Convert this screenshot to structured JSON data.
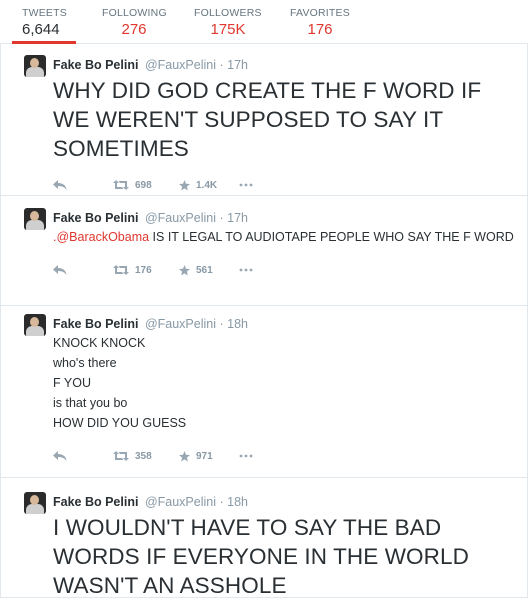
{
  "profile_stats": {
    "tweets": {
      "label": "TWEETS",
      "value": "6,644"
    },
    "following": {
      "label": "FOLLOWING",
      "value": "276"
    },
    "followers": {
      "label": "FOLLOWERS",
      "value": "175K"
    },
    "favorites": {
      "label": "FAVORITES",
      "value": "176"
    }
  },
  "colors": {
    "accent": "#e0372f",
    "muted": "#8899a6",
    "text": "#292f33",
    "border": "#e1e8ed"
  },
  "icons": {
    "reply": "reply-arrow-icon",
    "retweet": "retweet-icon",
    "favorite": "star-icon",
    "more": "ellipsis-icon"
  },
  "tweets": [
    {
      "fullname": "Fake Bo Pelini",
      "username": "@FauxPelini",
      "separator": "·",
      "time": "17h",
      "text": "WHY DID GOD CREATE THE F WORD IF WE WEREN'T SUPPOSED TO SAY IT SOMETIMES",
      "retweets": "698",
      "favorites": "1.4K"
    },
    {
      "fullname": "Fake Bo Pelini",
      "username": "@FauxPelini",
      "separator": "·",
      "time": "17h",
      "text_prefix": ".",
      "mention": "@BarackObama",
      "text": " IS IT LEGAL TO AUDIOTAPE PEOPLE WHO SAY THE F WORD",
      "retweets": "176",
      "favorites": "561"
    },
    {
      "fullname": "Fake Bo Pelini",
      "username": "@FauxPelini",
      "separator": "·",
      "time": "18h",
      "lines": [
        "KNOCK KNOCK",
        "who's there",
        "F YOU",
        "is that you bo",
        "HOW DID YOU GUESS"
      ],
      "retweets": "358",
      "favorites": "971"
    },
    {
      "fullname": "Fake Bo Pelini",
      "username": "@FauxPelini",
      "separator": "·",
      "time": "18h",
      "text": "I WOULDN'T HAVE TO SAY THE BAD WORDS IF EVERYONE IN THE WORLD WASN'T AN ASSHOLE"
    }
  ]
}
